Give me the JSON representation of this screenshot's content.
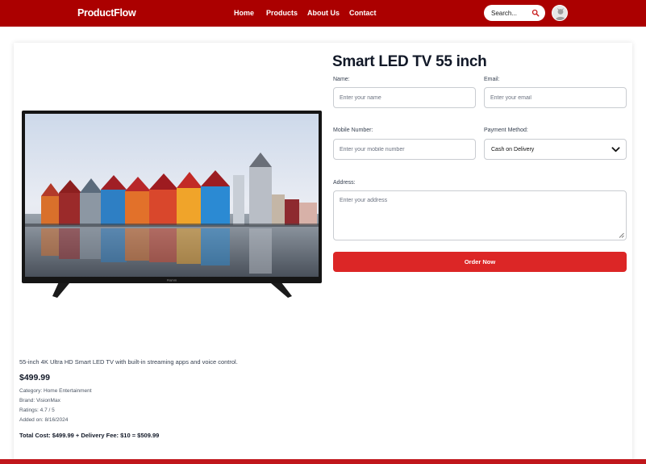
{
  "brand": "ProductFlow",
  "nav": {
    "home": "Home",
    "products": "Products",
    "about": "About Us",
    "contact": "Contact"
  },
  "search": {
    "placeholder": "Search..."
  },
  "product": {
    "title": "Smart LED TV 55 inch",
    "tv_brand_mark": "Flamm",
    "description": "55-inch 4K Ultra HD Smart LED TV with built-in streaming apps and voice control.",
    "price": "$499.99",
    "category": "Category: Home Entertainment",
    "brand": "Brand: VisionMax",
    "ratings": "Ratings: 4.7 / 5",
    "added": "Added on: 8/16/2024",
    "total": "Total Cost: $499.99 + Delivery Fee: $10 = $509.99"
  },
  "form": {
    "name_label": "Name:",
    "name_placeholder": "Enter your name",
    "email_label": "Email:",
    "email_placeholder": "Enter your email",
    "mobile_label": "Mobile Number:",
    "mobile_placeholder": "Enter your mobile number",
    "payment_label": "Payment Method:",
    "payment_selected": "Cash on Delivery",
    "address_label": "Address:",
    "address_placeholder": "Enter your address",
    "order_button": "Order Now"
  },
  "colors": {
    "header": "#ab0000",
    "button": "#dc2626",
    "footer": "#c0161b"
  },
  "icons": [
    "search-icon",
    "avatar",
    "chevron-down-icon"
  ]
}
